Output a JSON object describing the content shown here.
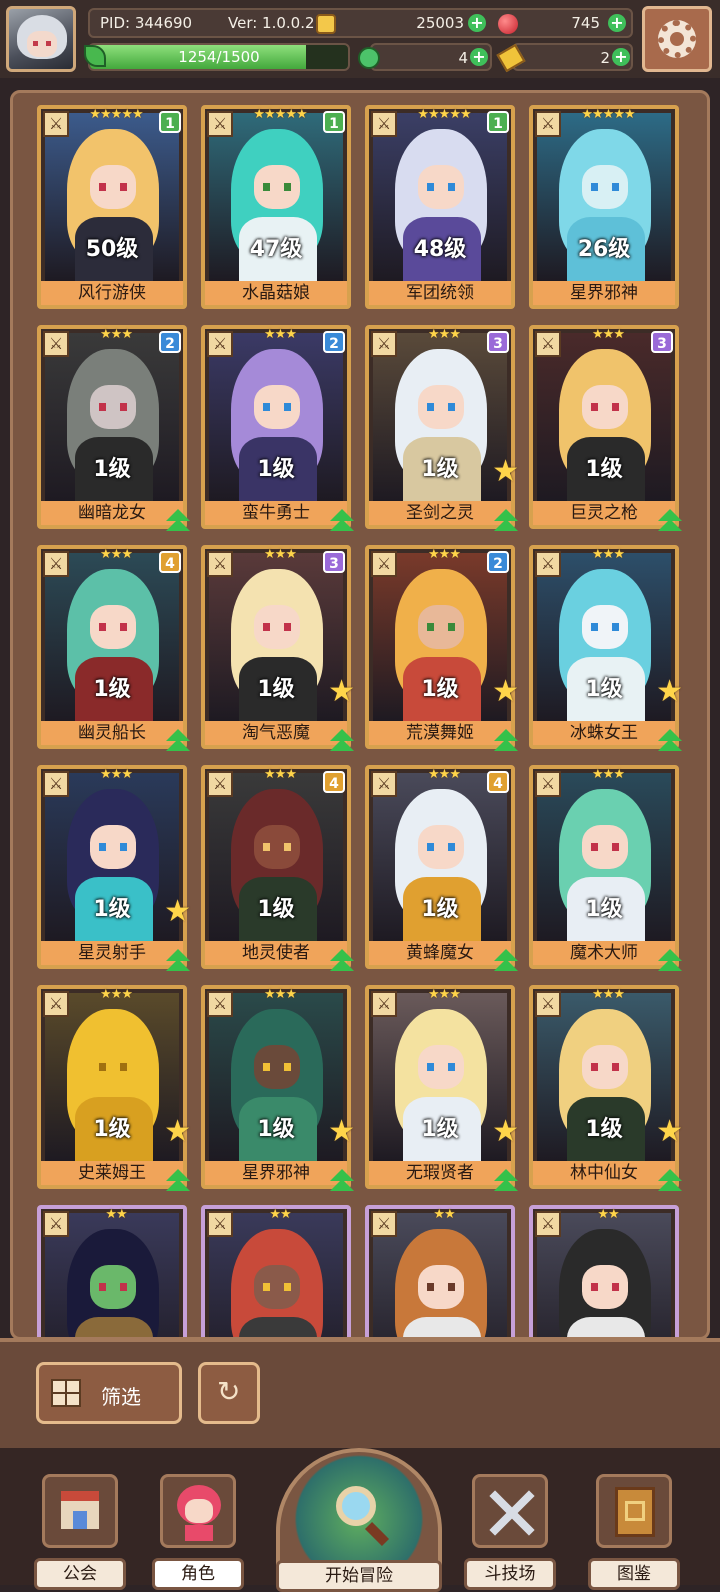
{
  "header": {
    "pid": "PID: 344690",
    "version": "Ver: 1.0.0.2",
    "coins": "25003",
    "gems": "745",
    "xp_text": "1254/1500",
    "xp_progress": 0.836,
    "clover_count": "4",
    "ticket_count": "2"
  },
  "cards": [
    {
      "name": "风行游侠",
      "level": "50级",
      "stars": "★★★★★",
      "rank": "1",
      "rank_color": "#4caf50",
      "frame": "gold",
      "bg": "#3c5b8c",
      "hair": "#f2c36b",
      "skin": "#f7d8c8",
      "eye": "#c2324a",
      "outfit": "#2c2c3a",
      "upgrade": false,
      "new_star": false
    },
    {
      "name": "水晶菇娘",
      "level": "47级",
      "stars": "★★★★★",
      "rank": "1",
      "rank_color": "#4caf50",
      "frame": "gold",
      "bg": "#2f6b7a",
      "hair": "#3fd0c0",
      "skin": "#f7d8c8",
      "eye": "#3a8a3a",
      "outfit": "#e8f2f4",
      "upgrade": false,
      "new_star": false
    },
    {
      "name": "军团统领",
      "level": "48级",
      "stars": "★★★★★",
      "rank": "1",
      "rank_color": "#4caf50",
      "frame": "gold",
      "bg": "#3b3f66",
      "hair": "#d8dcf0",
      "skin": "#f7d8c8",
      "eye": "#2f8ad8",
      "outfit": "#5a4a9a",
      "upgrade": false,
      "new_star": false
    },
    {
      "name": "星界邪神",
      "level": "26级",
      "stars": "★★★★★",
      "rank": "",
      "rank_color": "#5ab8e8",
      "frame": "gold",
      "bg": "#2d6b86",
      "hair": "#7fd8e8",
      "skin": "#d8f0f4",
      "eye": "#2f8ad8",
      "outfit": "#5ec0d8",
      "upgrade": false,
      "new_star": false
    },
    {
      "name": "幽暗龙女",
      "level": "1级",
      "stars": "★★★",
      "rank": "2",
      "rank_color": "#3a8ad8",
      "frame": "gold",
      "bg": "#3a3a3a",
      "hair": "#7a7f7a",
      "skin": "#cfc4c4",
      "eye": "#c2324a",
      "outfit": "#2a2a2a",
      "upgrade": true,
      "new_star": false
    },
    {
      "name": "蛮牛勇士",
      "level": "1级",
      "stars": "★★★",
      "rank": "2",
      "rank_color": "#3a8ad8",
      "frame": "gold",
      "bg": "#3b3a66",
      "hair": "#a58ad8",
      "skin": "#f7d8c8",
      "eye": "#2f8ad8",
      "outfit": "#3a3466",
      "upgrade": true,
      "new_star": false
    },
    {
      "name": "圣剑之灵",
      "level": "1级",
      "stars": "★★★",
      "rank": "3",
      "rank_color": "#9a6ad8",
      "frame": "gold",
      "bg": "#5a4a3a",
      "hair": "#e8eef4",
      "skin": "#f7d8c8",
      "eye": "#2f8ad8",
      "outfit": "#d8c8a0",
      "upgrade": true,
      "new_star": true
    },
    {
      "name": "巨灵之枪",
      "level": "1级",
      "stars": "★★★",
      "rank": "3",
      "rank_color": "#9a6ad8",
      "frame": "gold",
      "bg": "#4a2a2a",
      "hair": "#f0c36b",
      "skin": "#f7d8c8",
      "eye": "#c2324a",
      "outfit": "#2a2a2a",
      "upgrade": true,
      "new_star": false
    },
    {
      "name": "幽灵船长",
      "level": "1级",
      "stars": "★★★",
      "rank": "4",
      "rank_color": "#e0a030",
      "frame": "gold",
      "bg": "#2c4a56",
      "hair": "#5cc0a8",
      "skin": "#f7d8c8",
      "eye": "#c2324a",
      "outfit": "#8a2a2a",
      "upgrade": true,
      "new_star": false
    },
    {
      "name": "淘气恶魔",
      "level": "1级",
      "stars": "★★★",
      "rank": "3",
      "rank_color": "#9a6ad8",
      "frame": "gold",
      "bg": "#5a3a3a",
      "hair": "#f4e2b0",
      "skin": "#f7d8c8",
      "eye": "#c2324a",
      "outfit": "#2a2a2a",
      "upgrade": true,
      "new_star": true
    },
    {
      "name": "荒漠舞姬",
      "level": "1级",
      "stars": "★★★",
      "rank": "2",
      "rank_color": "#3a8ad8",
      "frame": "gold",
      "bg": "#7a3a2a",
      "hair": "#f0b04a",
      "skin": "#e8b898",
      "eye": "#3a8a3a",
      "outfit": "#c84a3a",
      "upgrade": true,
      "new_star": true
    },
    {
      "name": "冰蛛女王",
      "level": "1级",
      "stars": "★★★",
      "rank": "",
      "rank_color": "#5ab8e8",
      "frame": "gold",
      "bg": "#2d4f6a",
      "hair": "#6ad0e0",
      "skin": "#f0f4f8",
      "eye": "#2f8ad8",
      "outfit": "#e8f2f4",
      "upgrade": true,
      "new_star": true
    },
    {
      "name": "星灵射手",
      "level": "1级",
      "stars": "★★★",
      "rank": "",
      "rank_color": "#5ab8e8",
      "frame": "gold",
      "bg": "#2a3a5a",
      "hair": "#2a2a5a",
      "skin": "#f7d8c8",
      "eye": "#2f8ad8",
      "outfit": "#3ac0c8",
      "upgrade": true,
      "new_star": true
    },
    {
      "name": "地灵使者",
      "level": "1级",
      "stars": "★★★",
      "rank": "4",
      "rank_color": "#e0a030",
      "frame": "gold",
      "bg": "#3a3a3a",
      "hair": "#6a2a2a",
      "skin": "#8a4a3a",
      "eye": "#f0c36b",
      "outfit": "#2a3a2a",
      "upgrade": true,
      "new_star": false
    },
    {
      "name": "黄蜂魔女",
      "level": "1级",
      "stars": "★★★",
      "rank": "4",
      "rank_color": "#e0a030",
      "frame": "gold",
      "bg": "#4a4a5a",
      "hair": "#e8eef4",
      "skin": "#f7d8c8",
      "eye": "#2f8ad8",
      "outfit": "#e0a030",
      "upgrade": true,
      "new_star": false
    },
    {
      "name": "魔术大师",
      "level": "1级",
      "stars": "★★★",
      "rank": "",
      "rank_color": "#5ab8e8",
      "frame": "gold",
      "bg": "#2a4a5a",
      "hair": "#6ad0b0",
      "skin": "#f7d8c8",
      "eye": "#c2324a",
      "outfit": "#e8eef4",
      "upgrade": true,
      "new_star": false
    },
    {
      "name": "史莱姆王",
      "level": "1级",
      "stars": "★★★",
      "rank": "",
      "rank_color": "#5ab8e8",
      "frame": "gold",
      "bg": "#5a4a2a",
      "hair": "#f0c030",
      "skin": "#f0c030",
      "eye": "#a07010",
      "outfit": "#d8a020",
      "upgrade": true,
      "new_star": true
    },
    {
      "name": "星界邪神",
      "level": "1级",
      "stars": "★★★",
      "rank": "",
      "rank_color": "#6a6ad8",
      "frame": "gold",
      "bg": "#2a4a4a",
      "hair": "#2a6a5a",
      "skin": "#6a4a3a",
      "eye": "#f0c036",
      "outfit": "#3a8a6a",
      "upgrade": true,
      "new_star": true
    },
    {
      "name": "无瑕贤者",
      "level": "1级",
      "stars": "★★★",
      "rank": "",
      "rank_color": "#5ab8e8",
      "frame": "gold",
      "bg": "#6a5a5a",
      "hair": "#f4e2a0",
      "skin": "#f7d8c8",
      "eye": "#2f8ad8",
      "outfit": "#e8eef4",
      "upgrade": true,
      "new_star": true
    },
    {
      "name": "林中仙女",
      "level": "1级",
      "stars": "★★★",
      "rank": "",
      "rank_color": "#5ab8e8",
      "frame": "gold",
      "bg": "#3a5a6a",
      "hair": "#f0d080",
      "skin": "#f7d8c8",
      "eye": "#c2324a",
      "outfit": "#2a3a2a",
      "upgrade": true,
      "new_star": true
    },
    {
      "name": "",
      "level": "",
      "stars": "★★",
      "rank": "",
      "rank_color": "#5ab8e8",
      "frame": "purple",
      "bg": "#3a3a5a",
      "hair": "#1a1a3a",
      "skin": "#6ab86a",
      "eye": "#c2324a",
      "outfit": "#8a6a3a",
      "upgrade": false,
      "new_star": false
    },
    {
      "name": "",
      "level": "",
      "stars": "★★",
      "rank": "",
      "rank_color": "#5ab8e8",
      "frame": "purple",
      "bg": "#3a3a5a",
      "hair": "#c84a3a",
      "skin": "#8a5a4a",
      "eye": "#f0c036",
      "outfit": "#3a3a3a",
      "upgrade": false,
      "new_star": false
    },
    {
      "name": "",
      "level": "",
      "stars": "★★",
      "rank": "",
      "rank_color": "#5ab8e8",
      "frame": "purple",
      "bg": "#4a4a5a",
      "hair": "#c8783a",
      "skin": "#f7d8c8",
      "eye": "#6a3a2a",
      "outfit": "#e8e8e8",
      "upgrade": false,
      "new_star": false
    },
    {
      "name": "",
      "level": "",
      "stars": "★★",
      "rank": "",
      "rank_color": "#5ab8e8",
      "frame": "purple",
      "bg": "#4a4a5a",
      "hair": "#2a2a2a",
      "skin": "#f7d8c8",
      "eye": "#c2324a",
      "outfit": "#e8e8e8",
      "upgrade": false,
      "new_star": false
    }
  ],
  "controls": {
    "filter_label": "筛选",
    "refresh_icon": "↻"
  },
  "nav": {
    "guild": "公会",
    "character": "角色",
    "adventure": "开始冒险",
    "arena": "斗技场",
    "codex": "图鉴"
  }
}
